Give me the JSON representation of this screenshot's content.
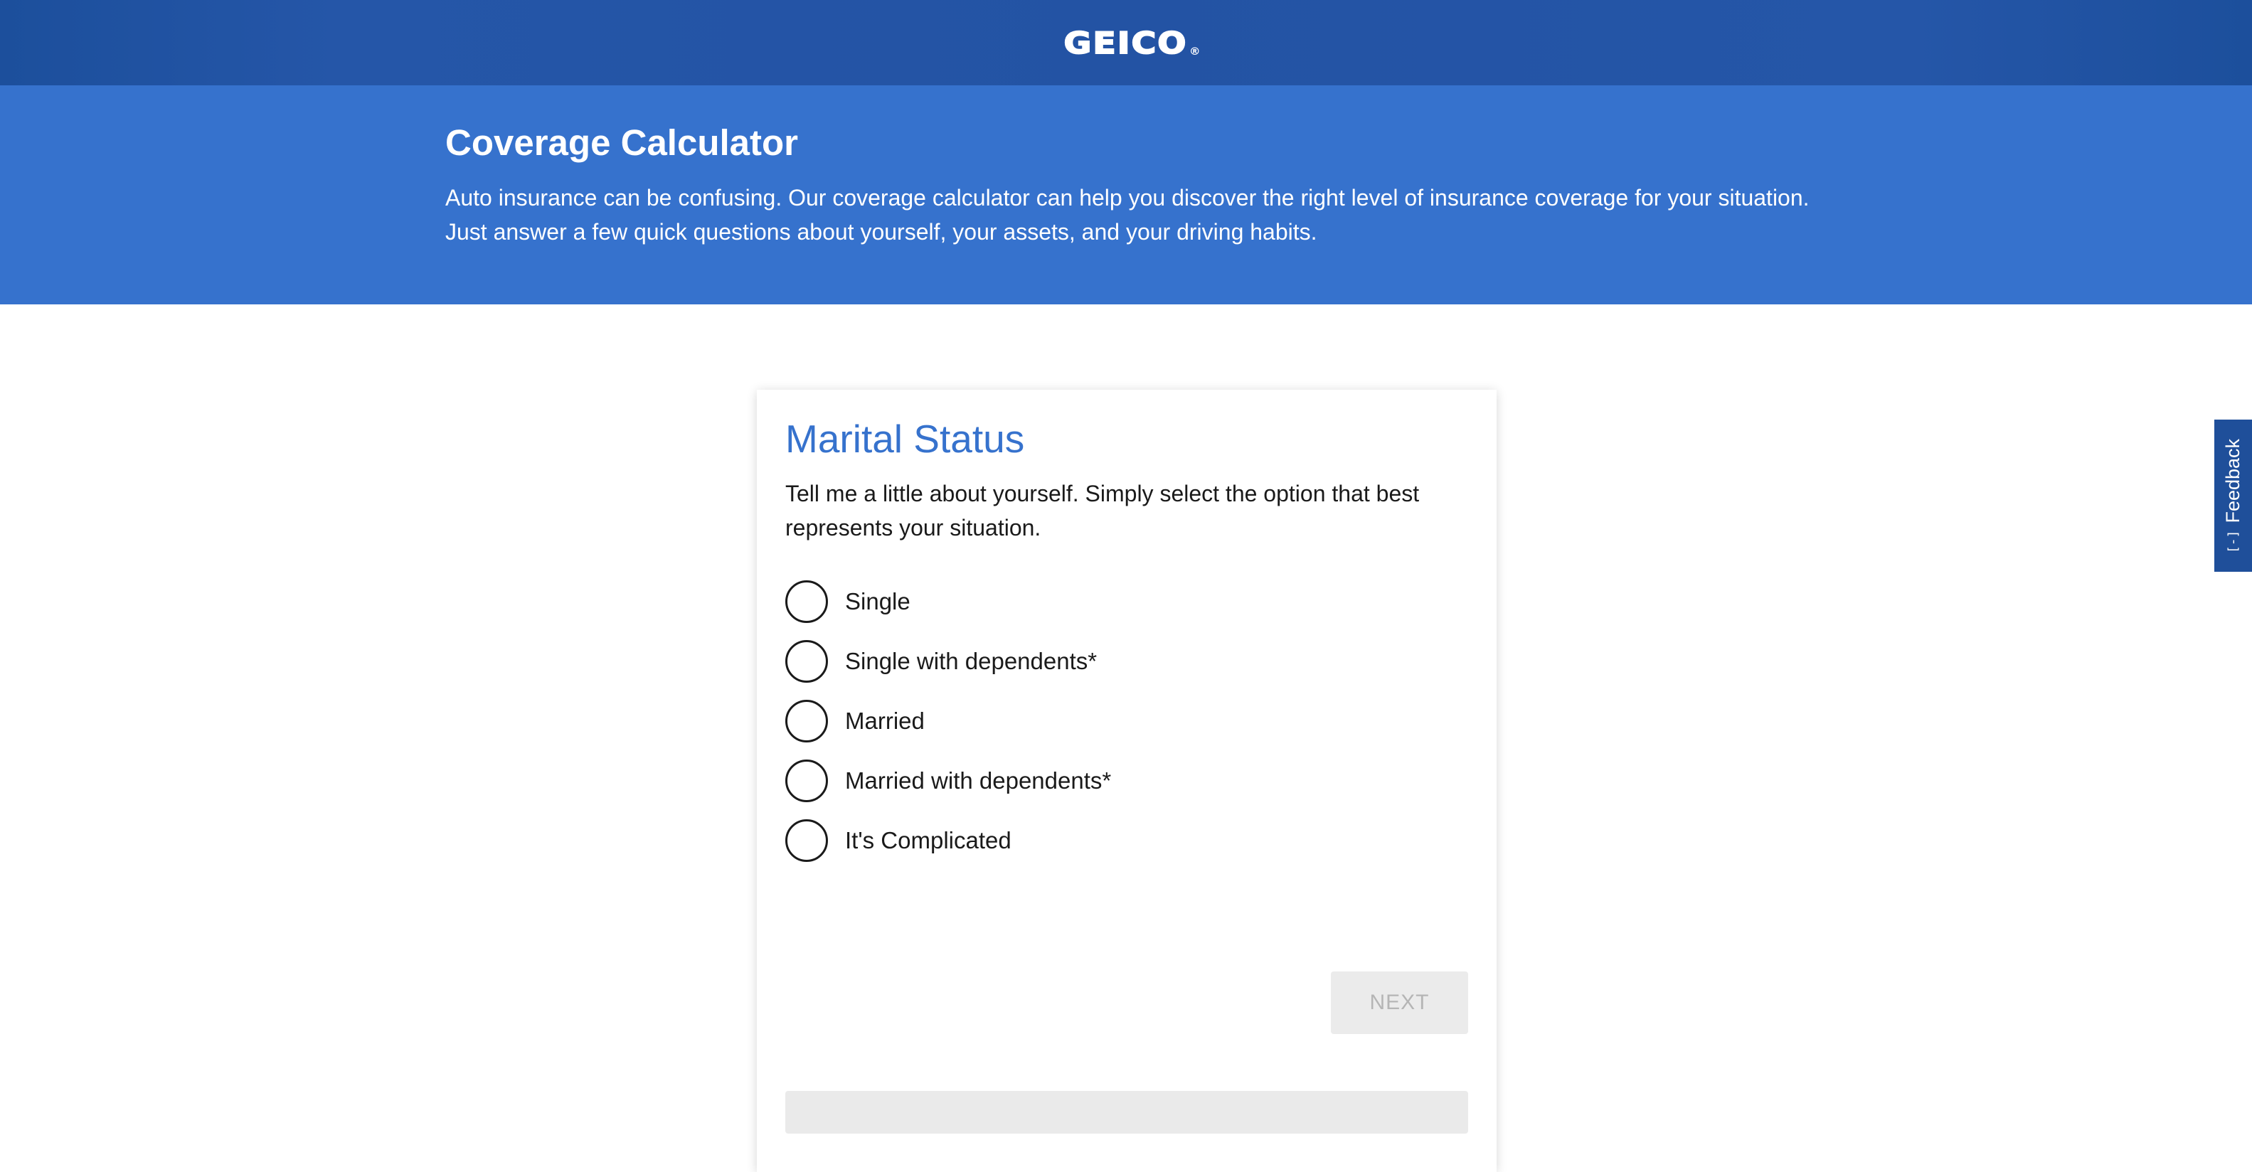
{
  "header": {
    "logo_text": "GEICO",
    "logo_reg": "®",
    "brand_color": "#2353a4"
  },
  "hero": {
    "title": "Coverage Calculator",
    "description_lines": [
      "Auto insurance can be confusing. Our coverage calculator can help you discover the right level of insurance coverage for your situation.",
      "Just answer a few quick questions about yourself, your assets, and your driving habits."
    ],
    "background_color": "#3672cd"
  },
  "question": {
    "title": "Marital Status",
    "intro_lines": [
      "Tell me a little about yourself. Simply select the option that best",
      "represents your situation."
    ],
    "options": [
      {
        "label": "Single",
        "selected": false
      },
      {
        "label": "Single with dependents*",
        "selected": false
      },
      {
        "label": "Married",
        "selected": false
      },
      {
        "label": "Married with dependents*",
        "selected": false
      },
      {
        "label": "It's Complicated",
        "selected": false
      }
    ],
    "next_label": "NEXT",
    "next_enabled": false
  },
  "feedback": {
    "label": "Feedback",
    "icon": "[-]"
  }
}
